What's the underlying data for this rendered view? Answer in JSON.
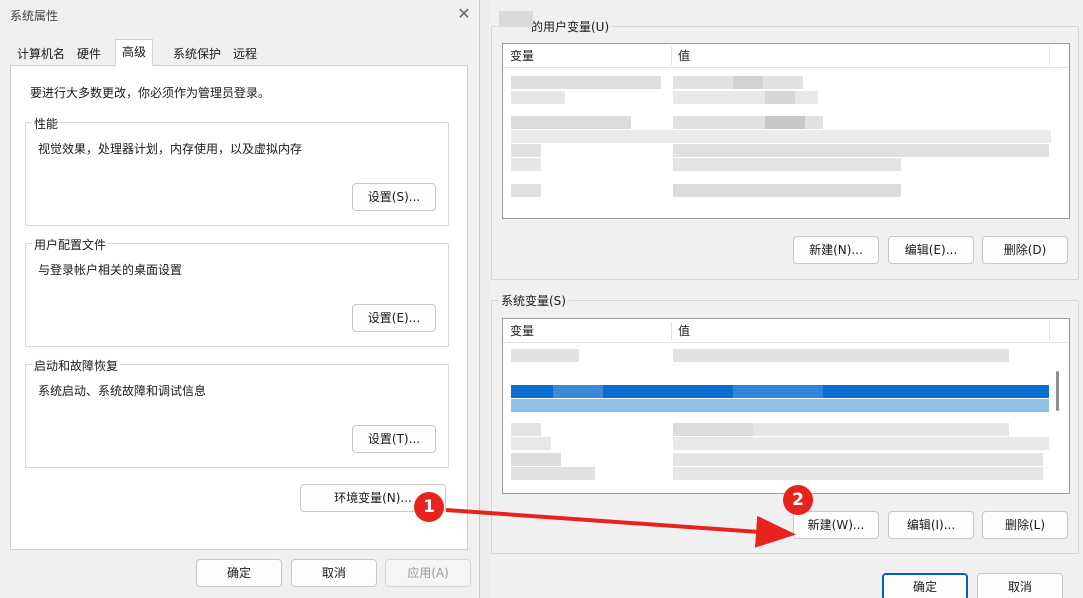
{
  "system_properties": {
    "title": "系统属性",
    "close_label": "✕",
    "tabs": [
      {
        "label": "计算机名"
      },
      {
        "label": "硬件"
      },
      {
        "label": "高级"
      },
      {
        "label": "系统保护"
      },
      {
        "label": "远程"
      }
    ],
    "active_tab": "高级",
    "admin_note": "要进行大多数更改，你必须作为管理员登录。",
    "performance": {
      "title": "性能",
      "desc": "视觉效果，处理器计划，内存使用，以及虚拟内存",
      "button": "设置(S)..."
    },
    "user_profiles": {
      "title": "用户配置文件",
      "desc": "与登录帐户相关的桌面设置",
      "button": "设置(E)..."
    },
    "startup_recovery": {
      "title": "启动和故障恢复",
      "desc": "系统启动、系统故障和调试信息",
      "button": "设置(T)..."
    },
    "env_button": "环境变量(N)...",
    "footer": {
      "ok": "确定",
      "cancel": "取消",
      "apply": "应用(A)"
    }
  },
  "environment_variables": {
    "user_section": {
      "title": "的用户变量(U)",
      "col_var": "变量",
      "col_val": "值",
      "buttons": {
        "new": "新建(N)...",
        "edit": "编辑(E)...",
        "delete": "删除(D)"
      }
    },
    "system_section": {
      "title": "系统变量(S)",
      "col_var": "变量",
      "col_val": "值",
      "buttons": {
        "new": "新建(W)...",
        "edit": "编辑(I)...",
        "delete": "删除(L)"
      }
    },
    "footer": {
      "ok": "确定",
      "cancel": "取消"
    }
  },
  "annotations": [
    {
      "label": "1"
    },
    {
      "label": "2"
    }
  ],
  "colors": {
    "annotation_red": "#e8231d",
    "selection_blue": "#0a6fd1",
    "selection_light_blue": "#8fbfe6",
    "accent_border": "#005fb8"
  }
}
